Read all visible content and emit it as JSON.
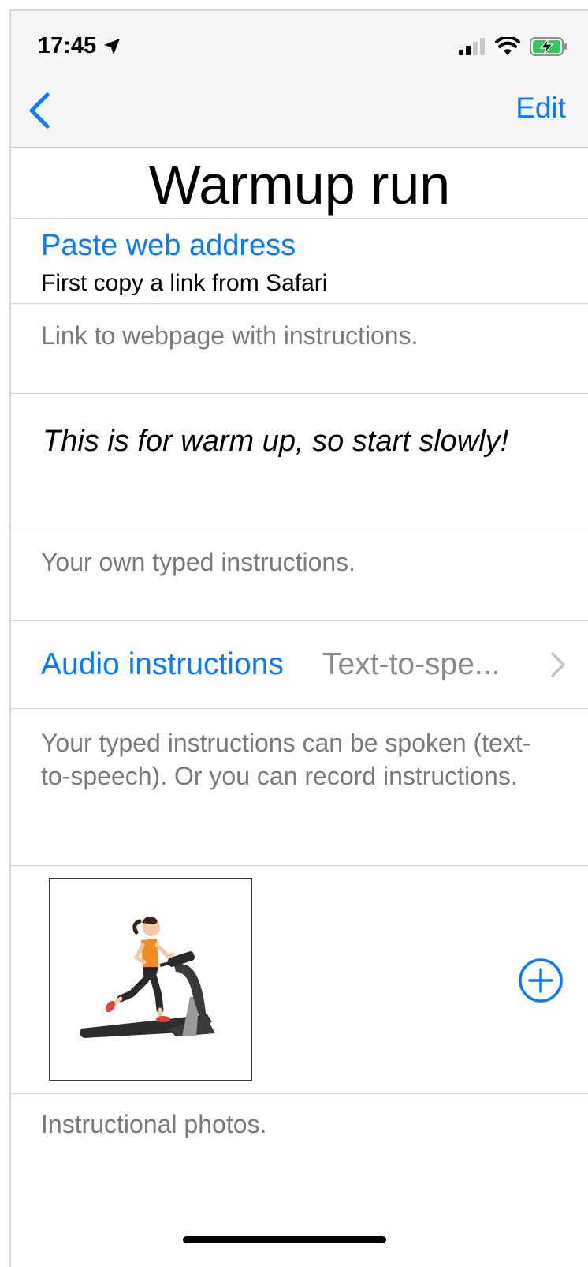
{
  "status_bar": {
    "time": "17:45"
  },
  "nav": {
    "edit_label": "Edit"
  },
  "title": "Warmup run",
  "web_link": {
    "button_label": "Paste web address",
    "subtitle": "First copy a link from Safari",
    "footer": "Link to webpage with instructions."
  },
  "typed_instructions": {
    "text": "This is for warm up, so start slowly!",
    "footer": "Your own typed instructions."
  },
  "audio": {
    "label": "Audio instructions",
    "value": "Text-to-spe...",
    "footer": "Your typed instructions can be spoken (text-to-speech). Or you can record instructions."
  },
  "photos": {
    "footer": "Instructional photos."
  },
  "colors": {
    "accent": "#0a7aff",
    "secondary_text": "#7a7a7e",
    "battery_charge": "#34c759"
  }
}
